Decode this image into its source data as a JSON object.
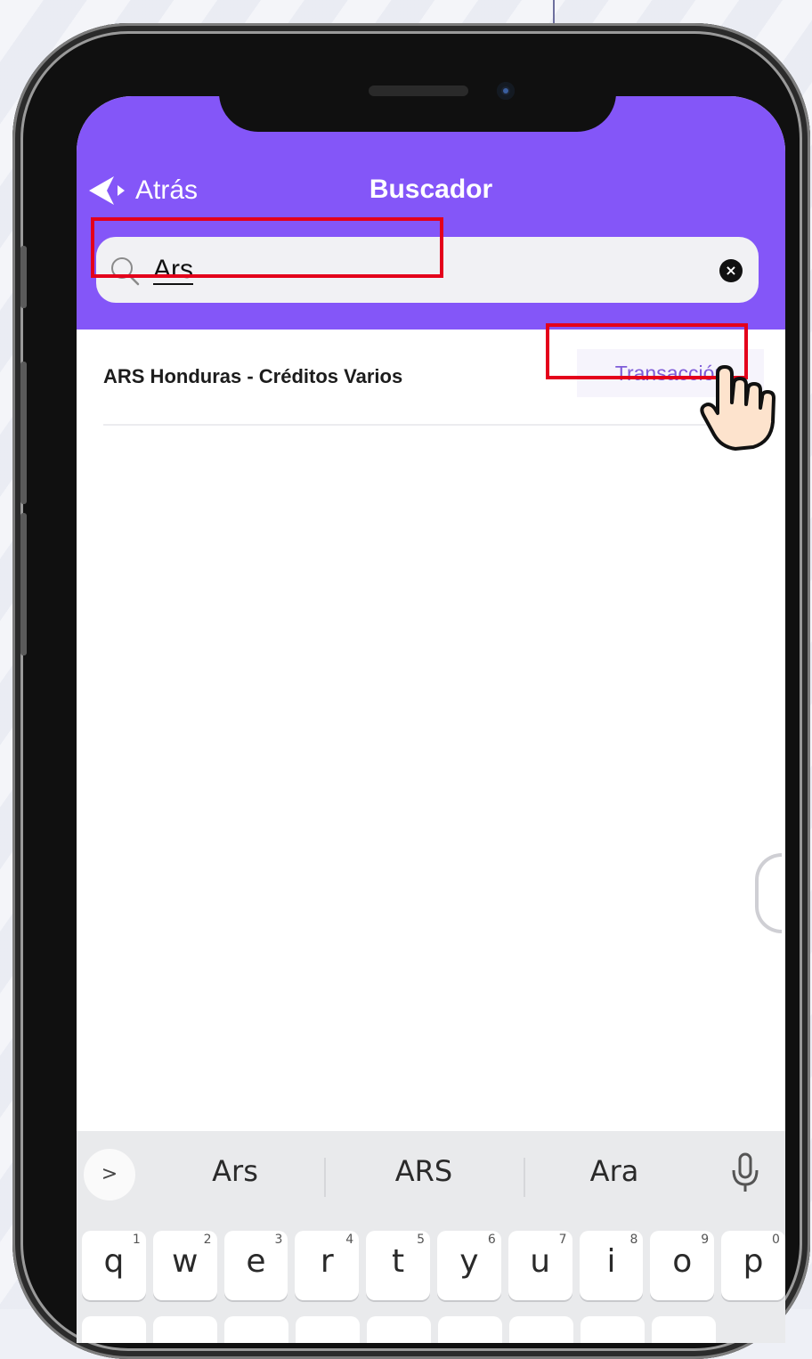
{
  "header": {
    "back_label": "Atrás",
    "title": "Buscador",
    "bg_color": "#8456f8"
  },
  "search": {
    "value": "Ars",
    "placeholder": ""
  },
  "results": [
    {
      "name": "ARS Honduras - Créditos Varios",
      "action_label": "Transacción"
    }
  ],
  "keyboard": {
    "suggestions": [
      "Ars",
      "ARS",
      "Ara"
    ],
    "row1": [
      {
        "letter": "q",
        "num": "1"
      },
      {
        "letter": "w",
        "num": "2"
      },
      {
        "letter": "e",
        "num": "3"
      },
      {
        "letter": "r",
        "num": "4"
      },
      {
        "letter": "t",
        "num": "5"
      },
      {
        "letter": "y",
        "num": "6"
      },
      {
        "letter": "u",
        "num": "7"
      },
      {
        "letter": "i",
        "num": "8"
      },
      {
        "letter": "o",
        "num": "9"
      },
      {
        "letter": "p",
        "num": "0"
      }
    ]
  },
  "highlight_color": "#e4001b"
}
